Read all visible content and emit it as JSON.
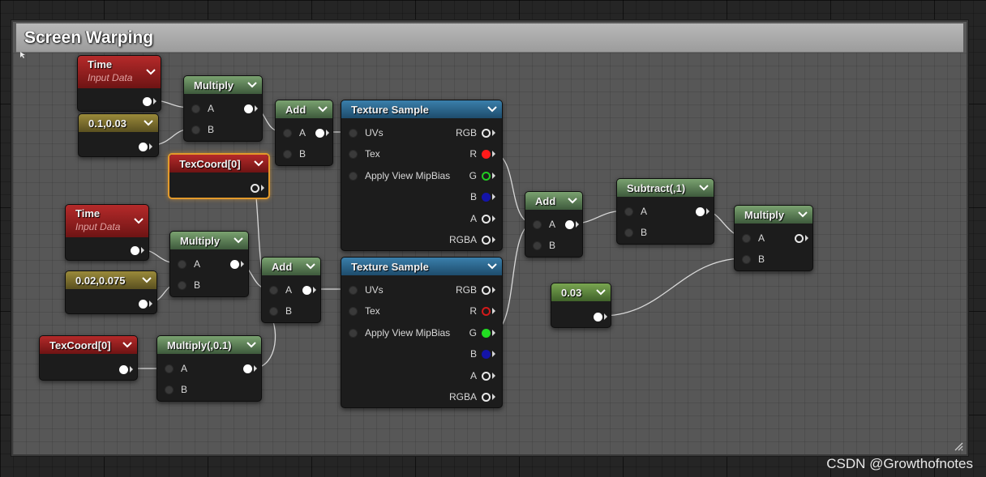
{
  "comment": {
    "title": "Screen Warping"
  },
  "nodes": {
    "time1": {
      "title": "Time",
      "subtitle": "Input Data"
    },
    "const2a": {
      "title": "0.1,0.03"
    },
    "mul1": {
      "title": "Multiply",
      "pins": [
        "A",
        "B"
      ]
    },
    "add1": {
      "title": "Add",
      "pins": [
        "A",
        "B"
      ]
    },
    "texcoord_sel": {
      "title": "TexCoord[0]"
    },
    "tex1": {
      "title": "Texture Sample",
      "inputs": [
        "UVs",
        "Tex",
        "Apply View MipBias"
      ],
      "outputs": [
        "RGB",
        "R",
        "G",
        "B",
        "A",
        "RGBA"
      ]
    },
    "time2": {
      "title": "Time",
      "subtitle": "Input Data"
    },
    "mul2": {
      "title": "Multiply",
      "pins": [
        "A",
        "B"
      ]
    },
    "const2b": {
      "title": "0.02,0.075"
    },
    "add2": {
      "title": "Add",
      "pins": [
        "A",
        "B"
      ]
    },
    "texcoord2": {
      "title": "TexCoord[0]"
    },
    "mul3": {
      "title": "Multiply(,0.1)",
      "pins": [
        "A",
        "B"
      ]
    },
    "tex2": {
      "title": "Texture Sample",
      "inputs": [
        "UVs",
        "Tex",
        "Apply View MipBias"
      ],
      "outputs": [
        "RGB",
        "R",
        "G",
        "B",
        "A",
        "RGBA"
      ]
    },
    "add3": {
      "title": "Add",
      "pins": [
        "A",
        "B"
      ]
    },
    "sub1": {
      "title": "Subtract(,1)",
      "pins": [
        "A",
        "B"
      ]
    },
    "const1": {
      "title": "0.03"
    },
    "mul4": {
      "title": "Multiply",
      "pins": [
        "A",
        "B"
      ]
    }
  },
  "colors": {
    "param_red": "#b52a2a",
    "math_green": "#7aa270",
    "const_olive": "#9a8a3a",
    "const_green": "#79a651",
    "texture_blue": "#3a7fab",
    "selection_orange": "#e39a2b"
  },
  "watermark": "CSDN @Growthofnotes"
}
